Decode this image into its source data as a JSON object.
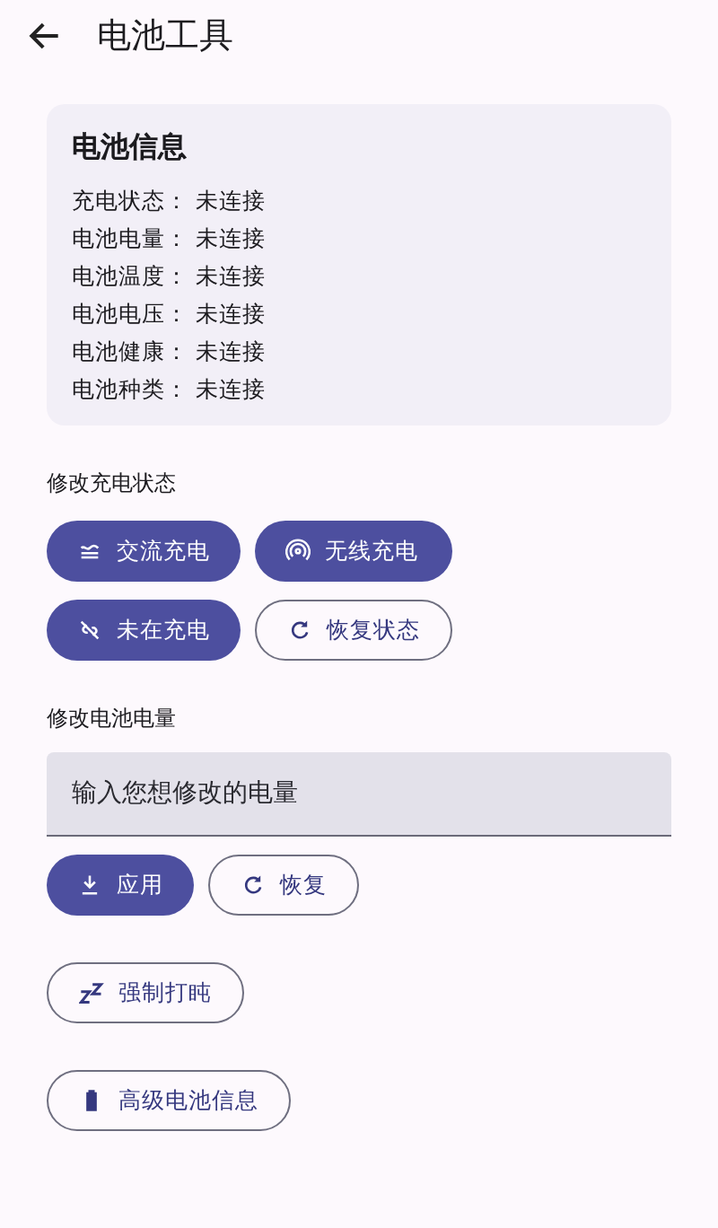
{
  "app_bar": {
    "title": "电池工具"
  },
  "info_card": {
    "title": "电池信息",
    "rows": [
      {
        "label": "充电状态：",
        "value": "未连接"
      },
      {
        "label": "电池电量：",
        "value": "未连接"
      },
      {
        "label": "电池温度：",
        "value": "未连接"
      },
      {
        "label": "电池电压：",
        "value": "未连接"
      },
      {
        "label": "电池健康：",
        "value": "未连接"
      },
      {
        "label": "电池种类：",
        "value": "未连接"
      }
    ]
  },
  "charge_section": {
    "label": "修改充电状态",
    "buttons": [
      {
        "label": "交流充电",
        "kind": "filled"
      },
      {
        "label": "无线充电",
        "kind": "filled"
      },
      {
        "label": "未在充电",
        "kind": "filled"
      },
      {
        "label": "恢复状态",
        "kind": "outlined"
      }
    ]
  },
  "level_section": {
    "label": "修改电池电量",
    "field": {
      "placeholder": "输入您想修改的电量"
    },
    "buttons": [
      {
        "label": "应用",
        "kind": "filled"
      },
      {
        "label": "恢复",
        "kind": "outlined"
      }
    ]
  },
  "extra_buttons": [
    {
      "label": "强制打盹",
      "kind": "outlined"
    },
    {
      "label": "高级电池信息",
      "kind": "outlined"
    }
  ]
}
